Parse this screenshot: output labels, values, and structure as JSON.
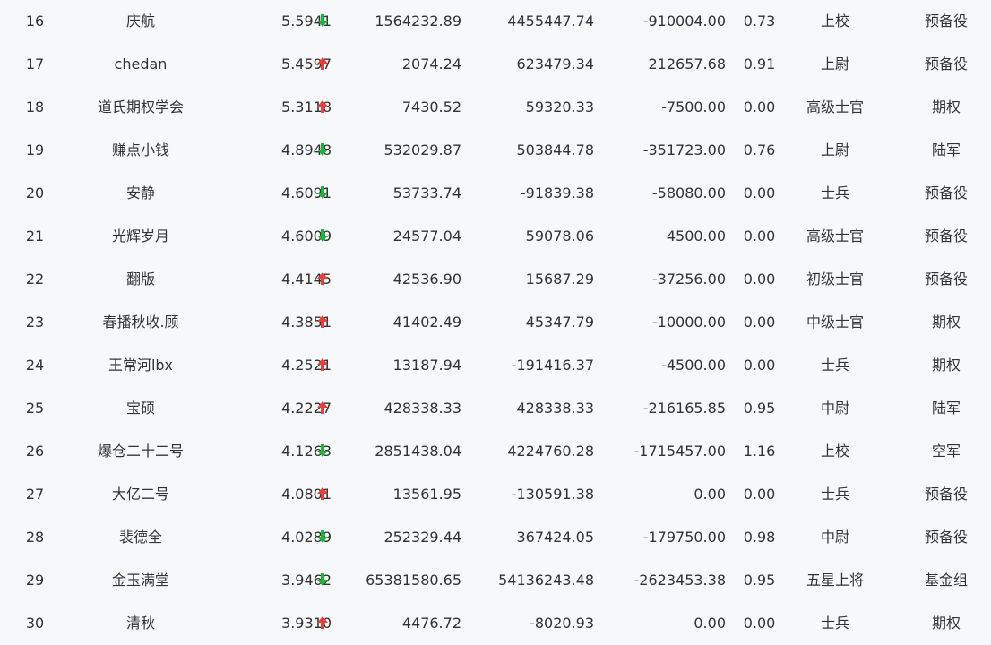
{
  "colors": {
    "background": "#f7f8fa",
    "text": "#333333",
    "up": "#e83e3e",
    "down": "#1fb33a"
  },
  "rows": [
    {
      "rank": "16",
      "name": "庆航",
      "score": "5.5941",
      "trend": "down",
      "v1": "1564232.89",
      "v2": "4455447.74",
      "v3": "-910004.00",
      "ratio": "0.73",
      "rank_name": "上校",
      "group": "预备役"
    },
    {
      "rank": "17",
      "name": "chedan",
      "score": "5.4597",
      "trend": "up",
      "v1": "2074.24",
      "v2": "623479.34",
      "v3": "212657.68",
      "ratio": "0.91",
      "rank_name": "上尉",
      "group": "预备役"
    },
    {
      "rank": "18",
      "name": "道氏期权学会",
      "score": "5.3118",
      "trend": "up",
      "v1": "7430.52",
      "v2": "59320.33",
      "v3": "-7500.00",
      "ratio": "0.00",
      "rank_name": "高级士官",
      "group": "期权"
    },
    {
      "rank": "19",
      "name": "赚点小钱",
      "score": "4.8948",
      "trend": "down",
      "v1": "532029.87",
      "v2": "503844.78",
      "v3": "-351723.00",
      "ratio": "0.76",
      "rank_name": "上尉",
      "group": "陆军"
    },
    {
      "rank": "20",
      "name": "安静",
      "score": "4.6091",
      "trend": "down",
      "v1": "53733.74",
      "v2": "-91839.38",
      "v3": "-58080.00",
      "ratio": "0.00",
      "rank_name": "士兵",
      "group": "预备役"
    },
    {
      "rank": "21",
      "name": "光辉岁月",
      "score": "4.6009",
      "trend": "down",
      "v1": "24577.04",
      "v2": "59078.06",
      "v3": "4500.00",
      "ratio": "0.00",
      "rank_name": "高级士官",
      "group": "预备役"
    },
    {
      "rank": "22",
      "name": "翻版",
      "score": "4.4145",
      "trend": "up",
      "v1": "42536.90",
      "v2": "15687.29",
      "v3": "-37256.00",
      "ratio": "0.00",
      "rank_name": "初级士官",
      "group": "预备役"
    },
    {
      "rank": "23",
      "name": "春播秋收.顾",
      "score": "4.3851",
      "trend": "up",
      "v1": "41402.49",
      "v2": "45347.79",
      "v3": "-10000.00",
      "ratio": "0.00",
      "rank_name": "中级士官",
      "group": "期权"
    },
    {
      "rank": "24",
      "name": "王常河lbx",
      "score": "4.2521",
      "trend": "up",
      "v1": "13187.94",
      "v2": "-191416.37",
      "v3": "-4500.00",
      "ratio": "0.00",
      "rank_name": "士兵",
      "group": "期权"
    },
    {
      "rank": "25",
      "name": "宝硕",
      "score": "4.2227",
      "trend": "up",
      "v1": "428338.33",
      "v2": "428338.33",
      "v3": "-216165.85",
      "ratio": "0.95",
      "rank_name": "中尉",
      "group": "陆军"
    },
    {
      "rank": "26",
      "name": "爆仓二十二号",
      "score": "4.1263",
      "trend": "down",
      "v1": "2851438.04",
      "v2": "4224760.28",
      "v3": "-1715457.00",
      "ratio": "1.16",
      "rank_name": "上校",
      "group": "空军"
    },
    {
      "rank": "27",
      "name": "大亿二号",
      "score": "4.0801",
      "trend": "up",
      "v1": "13561.95",
      "v2": "-130591.38",
      "v3": "0.00",
      "ratio": "0.00",
      "rank_name": "士兵",
      "group": "预备役"
    },
    {
      "rank": "28",
      "name": "裴德全",
      "score": "4.0289",
      "trend": "down",
      "v1": "252329.44",
      "v2": "367424.05",
      "v3": "-179750.00",
      "ratio": "0.98",
      "rank_name": "中尉",
      "group": "预备役"
    },
    {
      "rank": "29",
      "name": "金玉满堂",
      "score": "3.9462",
      "trend": "down",
      "v1": "65381580.65",
      "v2": "54136243.48",
      "v3": "-2623453.38",
      "ratio": "0.95",
      "rank_name": "五星上将",
      "group": "基金组"
    },
    {
      "rank": "30",
      "name": "清秋",
      "score": "3.9310",
      "trend": "up",
      "v1": "4476.72",
      "v2": "-8020.93",
      "v3": "0.00",
      "ratio": "0.00",
      "rank_name": "士兵",
      "group": "期权"
    }
  ]
}
